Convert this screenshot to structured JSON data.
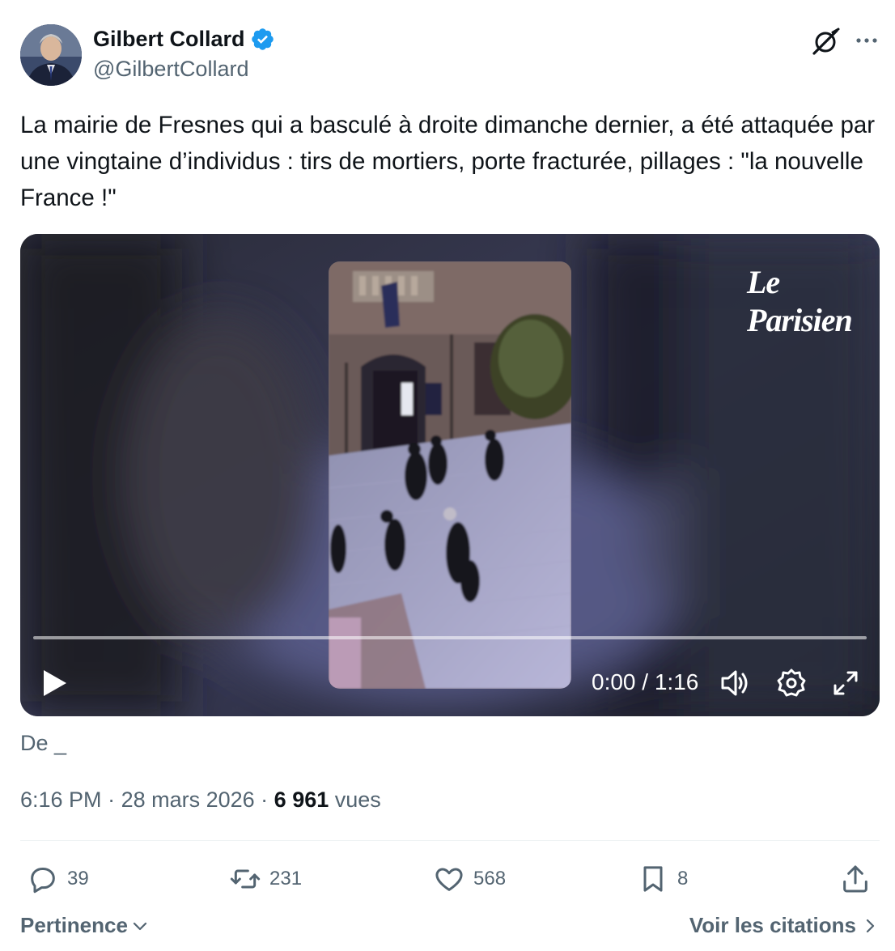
{
  "author": {
    "display_name": "Gilbert Collard",
    "handle": "@GilbertCollard",
    "avatar_icon": "person-portrait",
    "verified_color": "#1d9bf0"
  },
  "tweet": {
    "text": "La mairie de Fresnes qui a basculé à droite dimanche dernier, a été attaquée par une vingtaine d’individus : tirs de mortiers, porte fracturée, pillages : \"la nouvelle France !\""
  },
  "video": {
    "watermark": "Le Parisien",
    "time_display": "0:00 / 1:16",
    "progress": 0,
    "icons": [
      "play-icon",
      "volume-icon",
      "settings-icon",
      "fullscreen-icon"
    ]
  },
  "source": "De _",
  "meta": {
    "time": "6:16 PM",
    "separator": " · ",
    "date": "28 mars 2026",
    "views_count": "6 961",
    "views_label": "vues"
  },
  "actions": {
    "replies": "39",
    "reposts": "231",
    "likes": "568",
    "bookmarks": "8"
  },
  "footer": {
    "sort_label": "Pertinence",
    "quotes_label": "Voir les citations"
  },
  "colors": {
    "text": "#0f1419",
    "secondary": "#536471",
    "accent": "#1d9bf0"
  }
}
